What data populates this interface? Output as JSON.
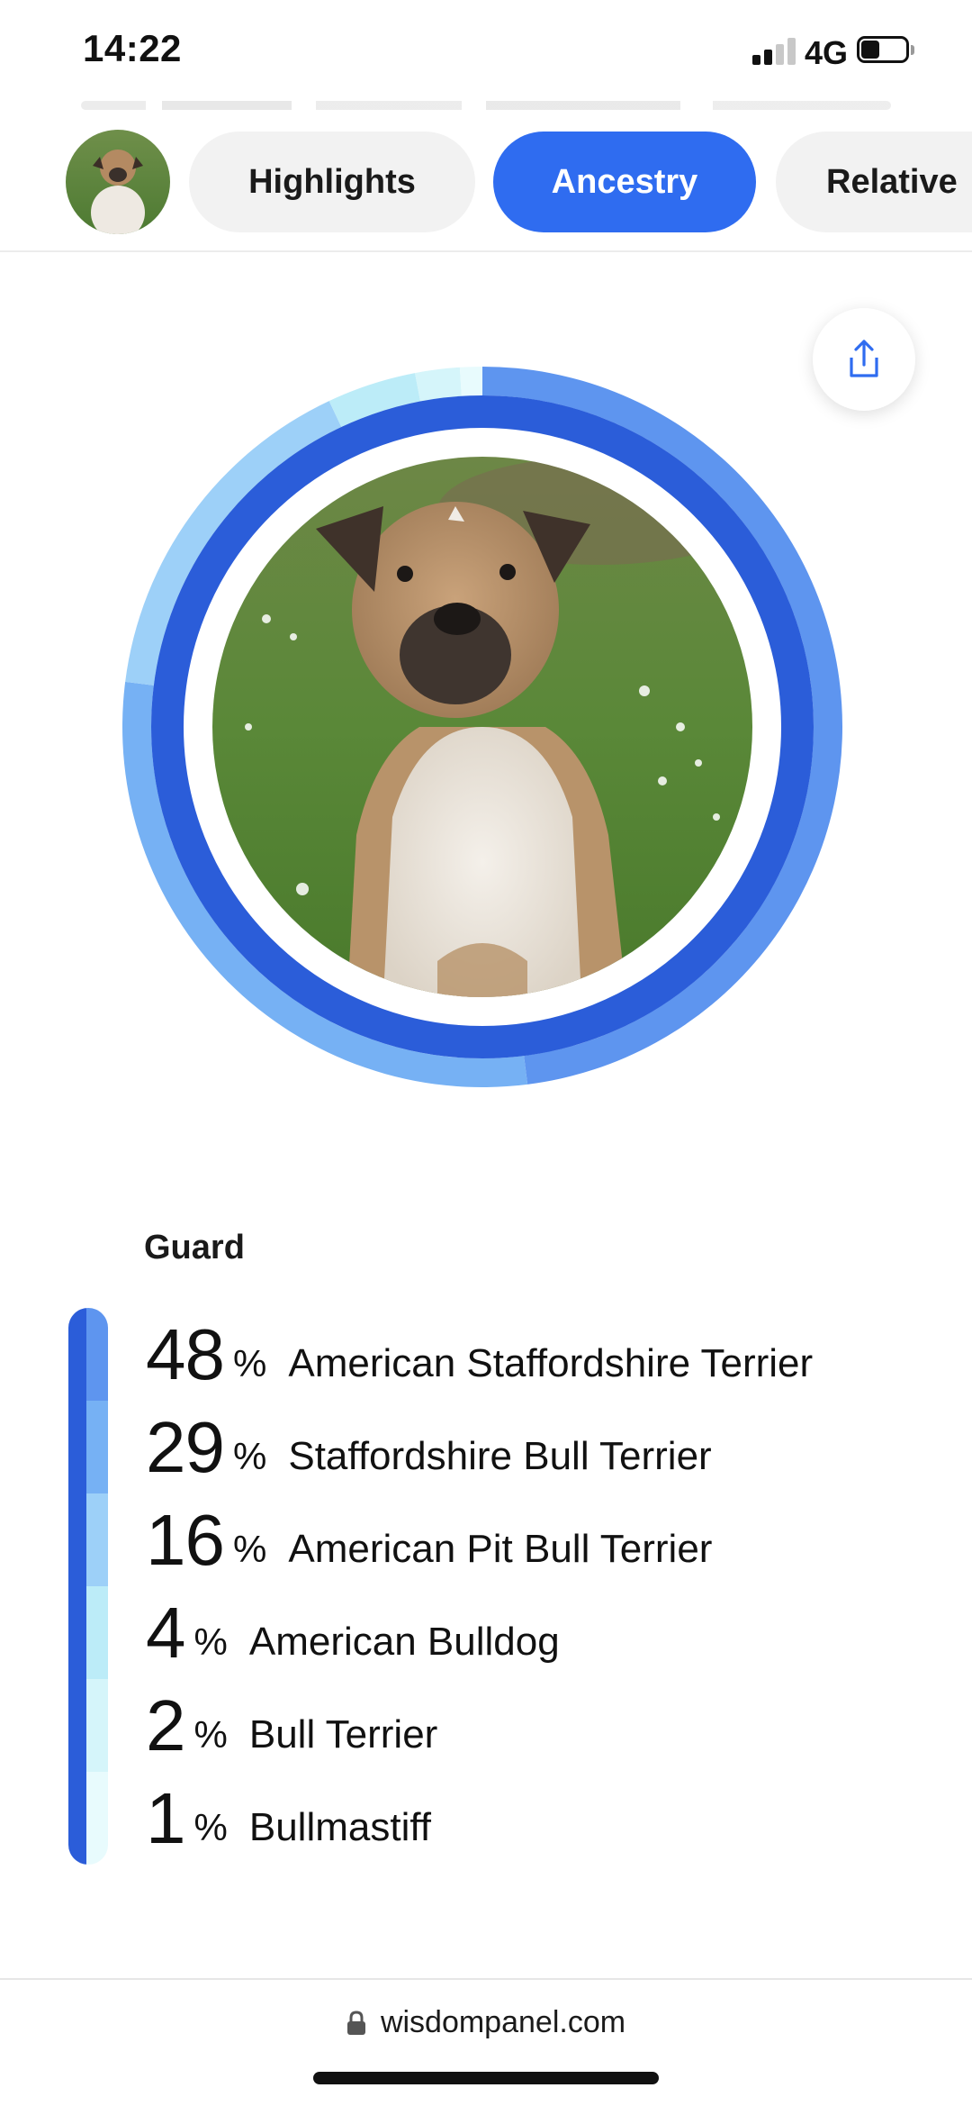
{
  "status_bar": {
    "time": "14:22",
    "network": "4G",
    "battery_level": 0.35
  },
  "tabs": [
    {
      "label": "Highlights",
      "active": false
    },
    {
      "label": "Ancestry",
      "active": true
    },
    {
      "label": "Relative",
      "active": false
    }
  ],
  "icons": {
    "avatar": "dog-avatar",
    "share": "share-icon",
    "lock": "lock-icon"
  },
  "colors": {
    "accent": "#2f6cf0",
    "ring_inner": "#2b5dd9",
    "tab_inactive_bg": "#f2f2f2"
  },
  "section_title": "Guard",
  "chart_data": {
    "type": "pie",
    "categories": [
      "American Staffordshire Terrier",
      "Staffordshire Bull Terrier",
      "American Pit Bull Terrier",
      "American Bulldog",
      "Bull Terrier",
      "Bullmastiff"
    ],
    "values": [
      48,
      29,
      16,
      4,
      2,
      1
    ],
    "colors": [
      "#5e95ef",
      "#76b1f4",
      "#9dd0f8",
      "#bcecf8",
      "#d5f5fa",
      "#e8fbfd"
    ]
  },
  "breeds": [
    {
      "pct": "48",
      "sign": "%",
      "name": "American Staffordshire Terrier"
    },
    {
      "pct": "29",
      "sign": "%",
      "name": "Staffordshire Bull Terrier"
    },
    {
      "pct": "16",
      "sign": "%",
      "name": "American Pit Bull Terrier"
    },
    {
      "pct": "4",
      "sign": "%",
      "name": "American Bulldog"
    },
    {
      "pct": "2",
      "sign": "%",
      "name": "Bull Terrier"
    },
    {
      "pct": "1",
      "sign": "%",
      "name": "Bullmastiff"
    }
  ],
  "footer": {
    "url": "wisdompanel.com"
  }
}
